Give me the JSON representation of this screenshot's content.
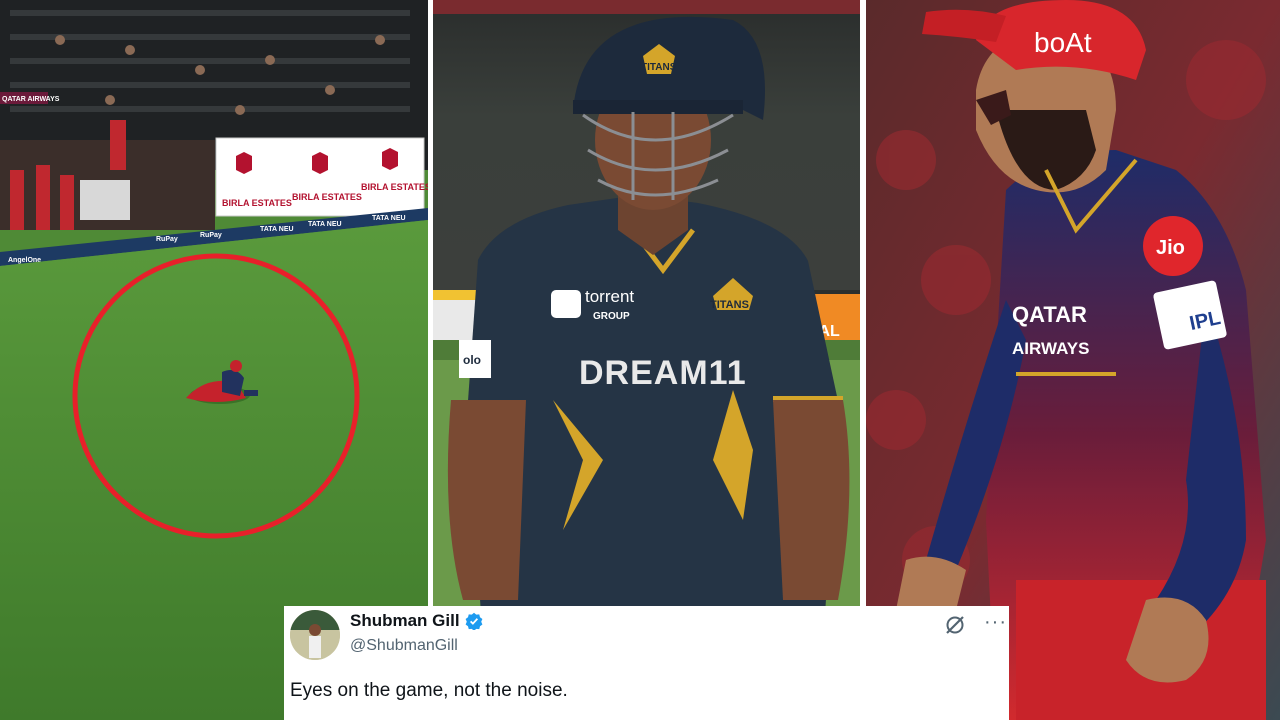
{
  "left_panel": {
    "board_brand": "BIRLA ESTATES",
    "ad_strip": [
      "AngelOne",
      "TATA NEU",
      "RuPay",
      "RuPay",
      "TATA NEU",
      "TATA NEU"
    ],
    "corner_sign": "QATAR AIRWAYS",
    "highlight_color": "#e8202a"
  },
  "middle_panel": {
    "helmet_logo": "TITANS",
    "chest_logo": "TITANS",
    "sponsor_top": "torrent",
    "sponsor_top_sub": "GROUP",
    "main_sponsor": "DREAM11",
    "sleeve_logo": "olo",
    "board_text": "PAL"
  },
  "right_panel": {
    "cap_brand": "boAt",
    "badge_sponsor": "Jio",
    "chest_sponsor_line1": "QATAR",
    "chest_sponsor_line2": "AIRWAYS",
    "league_badge": "IPL"
  },
  "tweet": {
    "name": "Shubman Gill",
    "handle": "@ShubmanGill",
    "text": "Eyes on the game, not the noise.",
    "verified_color": "#1d9bf0"
  }
}
